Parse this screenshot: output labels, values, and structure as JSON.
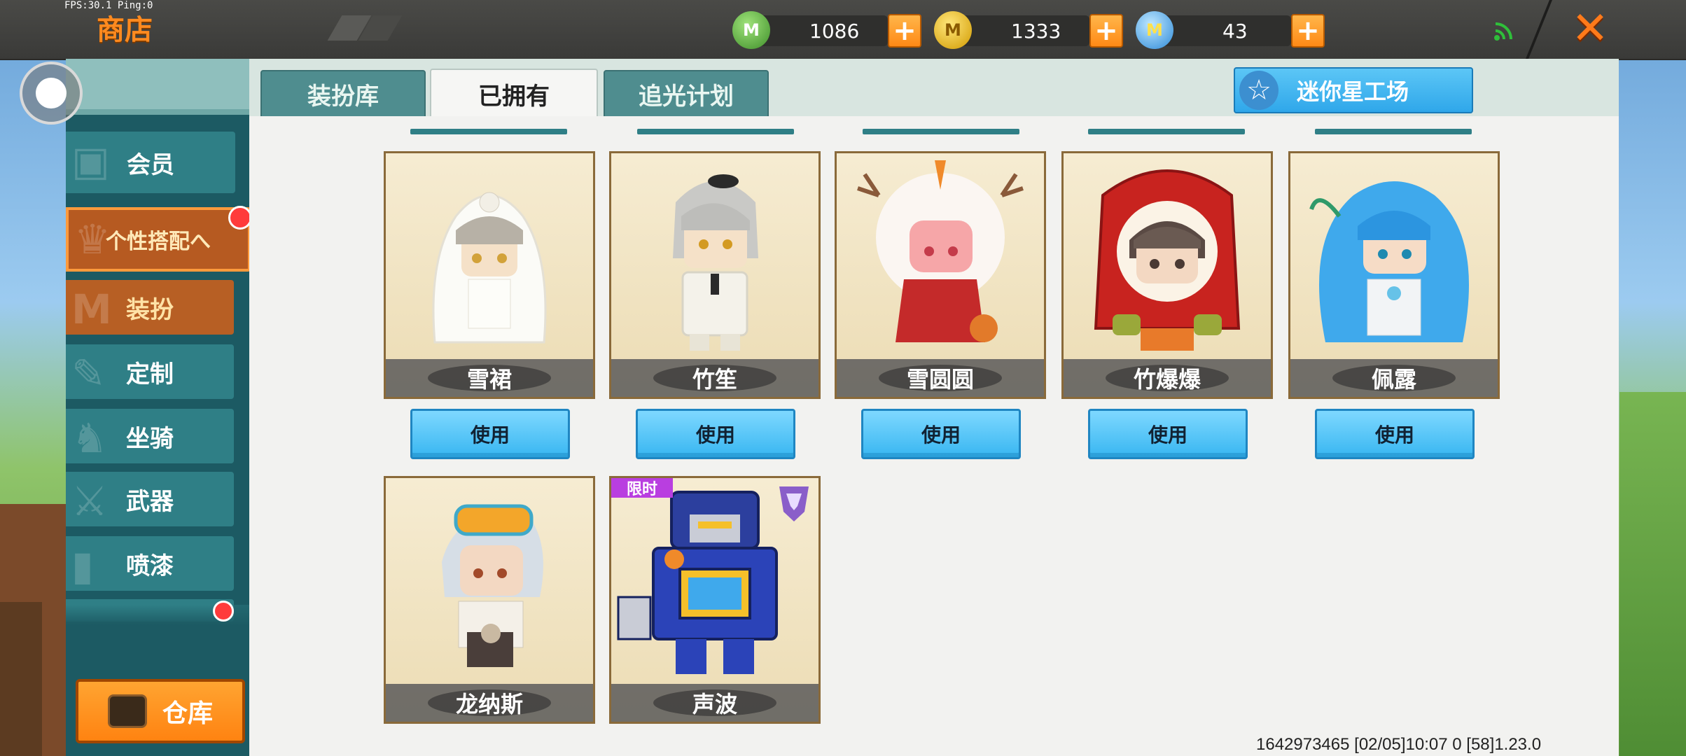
{
  "debug": {
    "fps_text": "FPS:30.1  Ping:0"
  },
  "header": {
    "title": "商店",
    "currencies": [
      {
        "icon": "green-minicoin-icon",
        "value": "1086",
        "color": "#5fb544"
      },
      {
        "icon": "gold-minicoin-icon",
        "value": "1333",
        "color": "#e8b51a"
      },
      {
        "icon": "blue-star-coin-icon",
        "value": "43",
        "color": "#3aa0e6"
      }
    ],
    "plus_label": "+",
    "close_label": "✕"
  },
  "sidebar": {
    "vip": "会员",
    "outfit_group": "个性搭配へ",
    "items": [
      {
        "label": "装扮",
        "active": true
      },
      {
        "label": "定制"
      },
      {
        "label": "坐骑"
      },
      {
        "label": "武器"
      },
      {
        "label": "喷漆"
      }
    ],
    "warehouse": "仓库"
  },
  "tabs": [
    {
      "label": "装扮库",
      "active": false
    },
    {
      "label": "已拥有",
      "active": true
    },
    {
      "label": "追光计划",
      "active": false
    }
  ],
  "studio_button": "迷你星工场",
  "skins": [
    {
      "name": "雪裙",
      "use": "使用"
    },
    {
      "name": "竹笙",
      "use": "使用"
    },
    {
      "name": "雪圆圆",
      "use": "使用"
    },
    {
      "name": "竹爆爆",
      "use": "使用"
    },
    {
      "name": "佩露",
      "use": "使用"
    },
    {
      "name": "龙纳斯"
    },
    {
      "name": "声波",
      "tag": "限时"
    }
  ],
  "footer": "1642973465   [02/05]10:07 0  [58]1.23.0"
}
